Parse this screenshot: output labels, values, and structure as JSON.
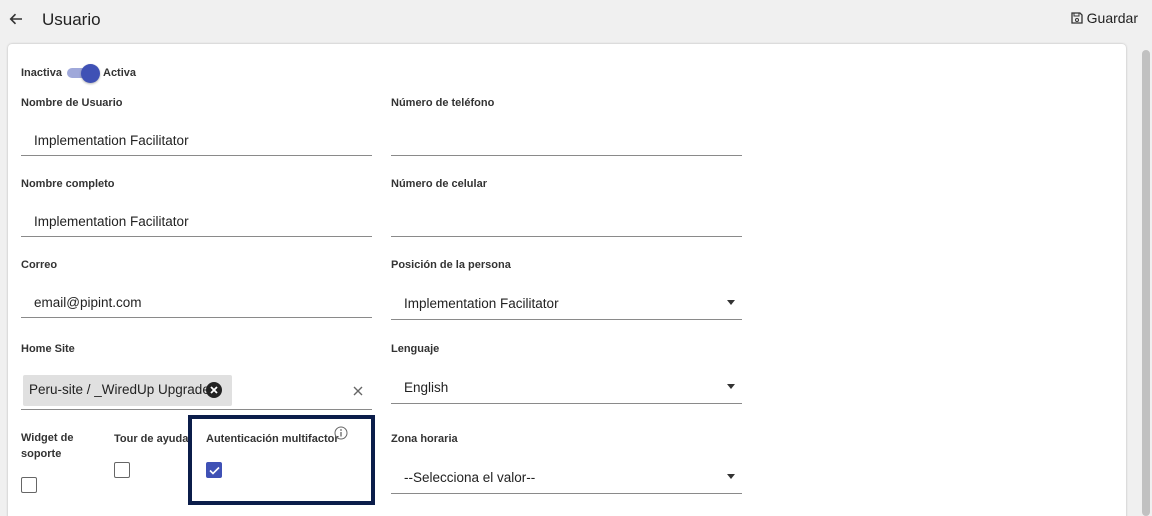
{
  "header": {
    "title": "Usuario",
    "back_icon": "arrow-left-icon",
    "save_label": "Guardar",
    "save_icon": "floppy-disk-icon"
  },
  "status_toggle": {
    "off_label": "Inactiva",
    "on_label": "Activa",
    "checked": true,
    "color": "#3f51b5"
  },
  "form": {
    "username": {
      "label": "Nombre de Usuario",
      "value": "Implementation Facilitator"
    },
    "phone": {
      "label": "Número de teléfono",
      "value": ""
    },
    "full_name": {
      "label": "Nombre completo",
      "value": "Implementation Facilitator"
    },
    "mobile": {
      "label": "Número de celular",
      "value": ""
    },
    "email": {
      "label": "Correo",
      "value": "email@pipint.com"
    },
    "position": {
      "label": "Posición de la persona",
      "value": "Implementation Facilitator"
    },
    "home_site": {
      "label": "Home Site",
      "chip": "Peru-site / _WiredUp Upgrade",
      "clear_icon": "close-icon"
    },
    "language": {
      "label": "Lenguaje",
      "value": "English"
    },
    "support_widget": {
      "label_line1": "Widget de",
      "label_line2": "soporte",
      "checked": false
    },
    "help_tour": {
      "label": "Tour de ayuda",
      "checked": false
    },
    "mfa": {
      "label": "Autenticación multifactor",
      "checked": true,
      "info_icon": "info-icon"
    },
    "timezone": {
      "label": "Zona horaria",
      "value": "--Selecciona el valor--"
    }
  }
}
